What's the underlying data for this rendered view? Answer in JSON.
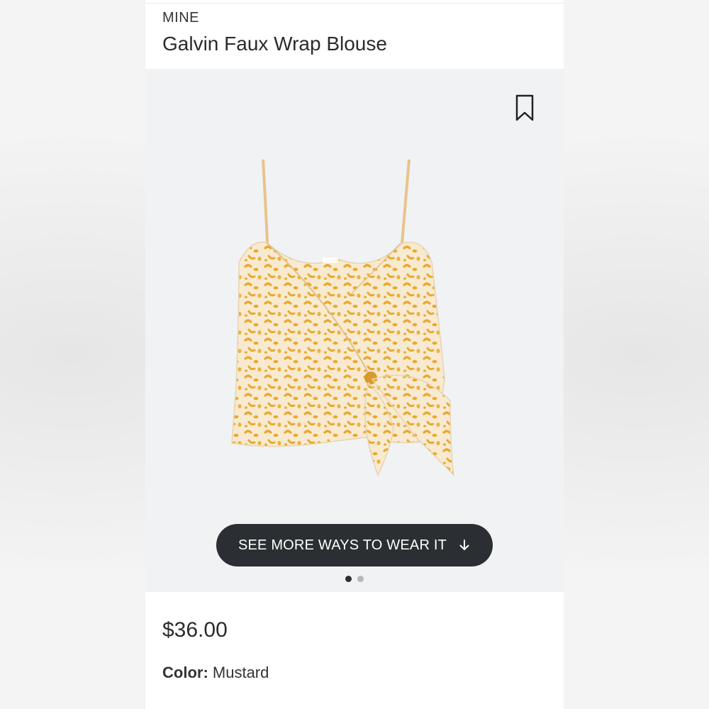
{
  "product": {
    "brand": "MINE",
    "title": "Galvin Faux Wrap Blouse",
    "price": "$36.00",
    "color_label": "Color:",
    "color_value": "Mustard"
  },
  "gallery": {
    "cta_label": "SEE MORE WAYS TO WEAR IT",
    "cta_icon": "arrow-down-icon",
    "bookmark_icon": "bookmark-icon",
    "image": "mustard leopard-print cami wrap blouse",
    "slide_count": 2,
    "active_slide": 1
  },
  "colors": {
    "gallery_bg": "#f1f2f4",
    "button_bg": "#2b2f33",
    "fabric_base": "#f8ead0",
    "fabric_print": "#e9a92f"
  }
}
